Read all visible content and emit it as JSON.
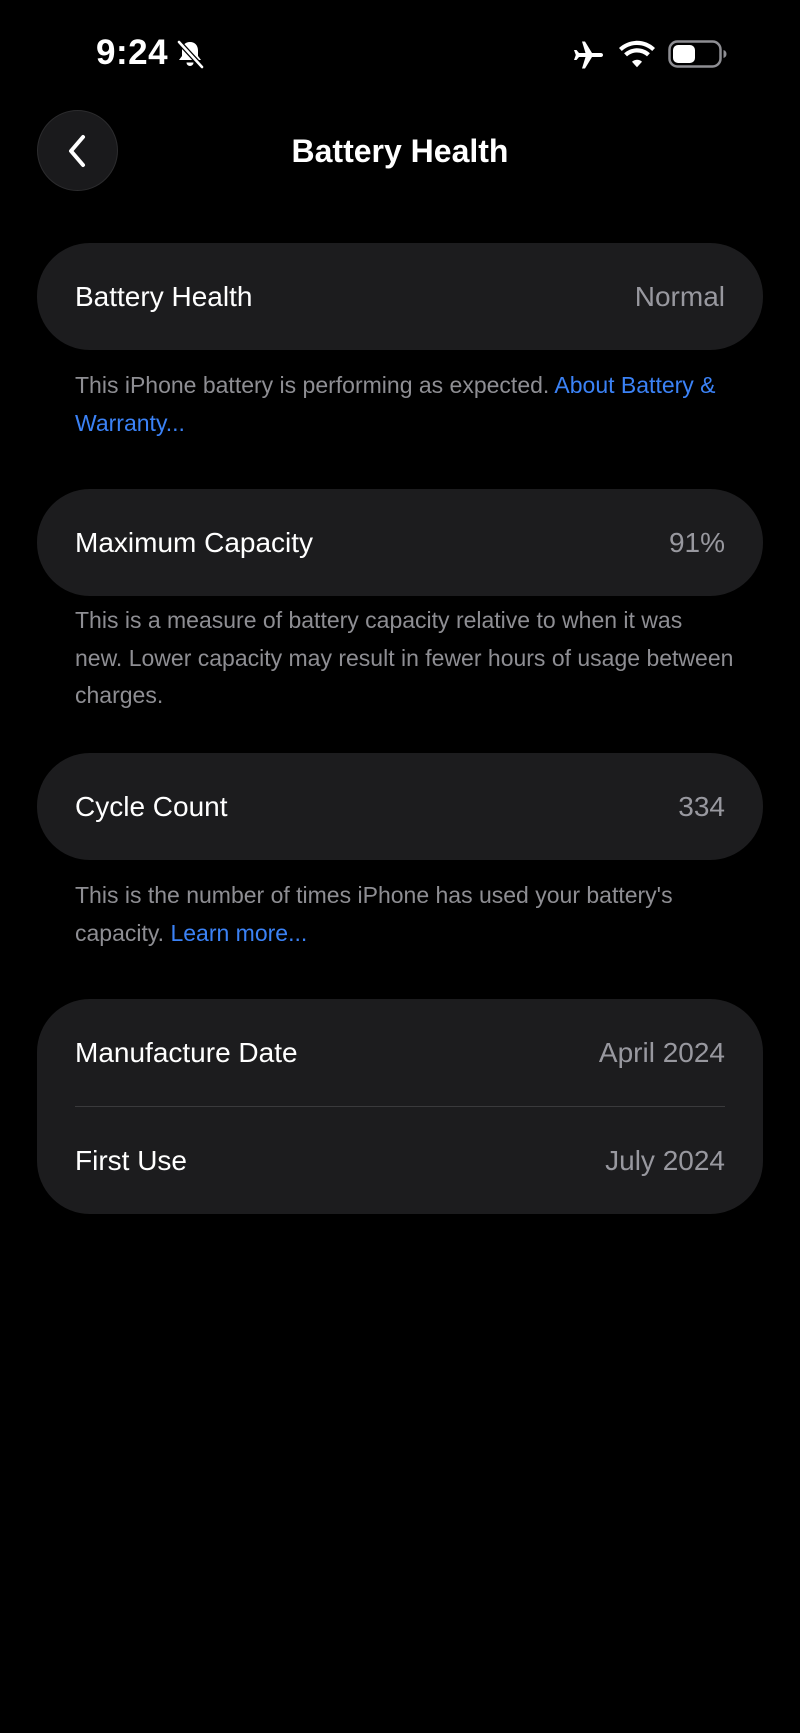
{
  "status_bar": {
    "time": "9:24",
    "icons": [
      "bell-slash-icon",
      "airplane-icon",
      "wifi-icon",
      "battery-icon"
    ]
  },
  "nav": {
    "title": "Battery Health",
    "back_icon": "chevron-left-icon"
  },
  "battery_health": {
    "label": "Battery Health",
    "value": "Normal",
    "note": "This iPhone battery is performing as expected. ",
    "note_link": "About Battery & Warranty..."
  },
  "maximum_capacity": {
    "label": "Maximum Capacity",
    "value": "91%",
    "note": "This is a measure of battery capacity relative to when it was new. Lower capacity may result in fewer hours of usage between charges."
  },
  "cycle_count": {
    "label": "Cycle Count",
    "value": "334",
    "note": "This is the number of times iPhone has used your battery's capacity. ",
    "note_link": "Learn more..."
  },
  "dates": {
    "manufacture_label": "Manufacture Date",
    "manufacture_value": "April 2024",
    "first_use_label": "First Use",
    "first_use_value": "July 2024"
  },
  "colors": {
    "background": "#000000",
    "card": "#1c1c1e",
    "secondary_text": "#98989f",
    "link": "#3b82f6"
  }
}
